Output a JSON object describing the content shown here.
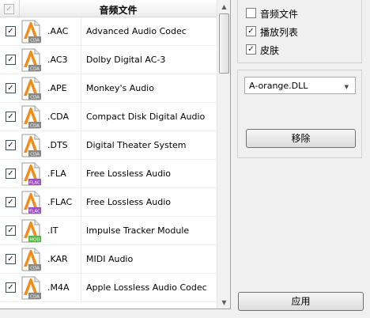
{
  "list": {
    "header_title": "音频文件",
    "rows": [
      {
        "ext": ".AAC",
        "desc": "Advanced Audio Codec",
        "tag": "CDA",
        "tag_color": "#888888"
      },
      {
        "ext": ".AC3",
        "desc": "Dolby Digital AC-3",
        "tag": "CDA",
        "tag_color": "#888888"
      },
      {
        "ext": ".APE",
        "desc": "Monkey's Audio",
        "tag": "CDA",
        "tag_color": "#888888"
      },
      {
        "ext": ".CDA",
        "desc": "Compact Disk Digital Audio",
        "tag": "CDA",
        "tag_color": "#888888"
      },
      {
        "ext": ".DTS",
        "desc": "Digital Theater System",
        "tag": "CDA",
        "tag_color": "#888888"
      },
      {
        "ext": ".FLA",
        "desc": "Free Lossless Audio",
        "tag": "FLAC",
        "tag_color": "#9b4fc2"
      },
      {
        "ext": ".FLAC",
        "desc": "Free Lossless Audio",
        "tag": "FLAC",
        "tag_color": "#9b4fc2"
      },
      {
        "ext": ".IT",
        "desc": "Impulse Tracker Module",
        "tag": "MOD",
        "tag_color": "#55b84a"
      },
      {
        "ext": ".KAR",
        "desc": "MIDI Audio",
        "tag": "CDA",
        "tag_color": "#888888"
      },
      {
        "ext": ".M4A",
        "desc": "Apple Lossless Audio Codec",
        "tag": "CDA",
        "tag_color": "#888888"
      }
    ]
  },
  "options": {
    "audio_files": {
      "label": "音频文件",
      "checked": false
    },
    "playlist": {
      "label": "播放列表",
      "checked": true
    },
    "skin": {
      "label": "皮肤",
      "checked": true
    }
  },
  "skin_select": {
    "value": "A-orange.DLL"
  },
  "buttons": {
    "remove": "移除",
    "apply": "应用"
  },
  "colors": {
    "icon_orange": "#f28c1a",
    "check_border": "#2d4d7c"
  }
}
